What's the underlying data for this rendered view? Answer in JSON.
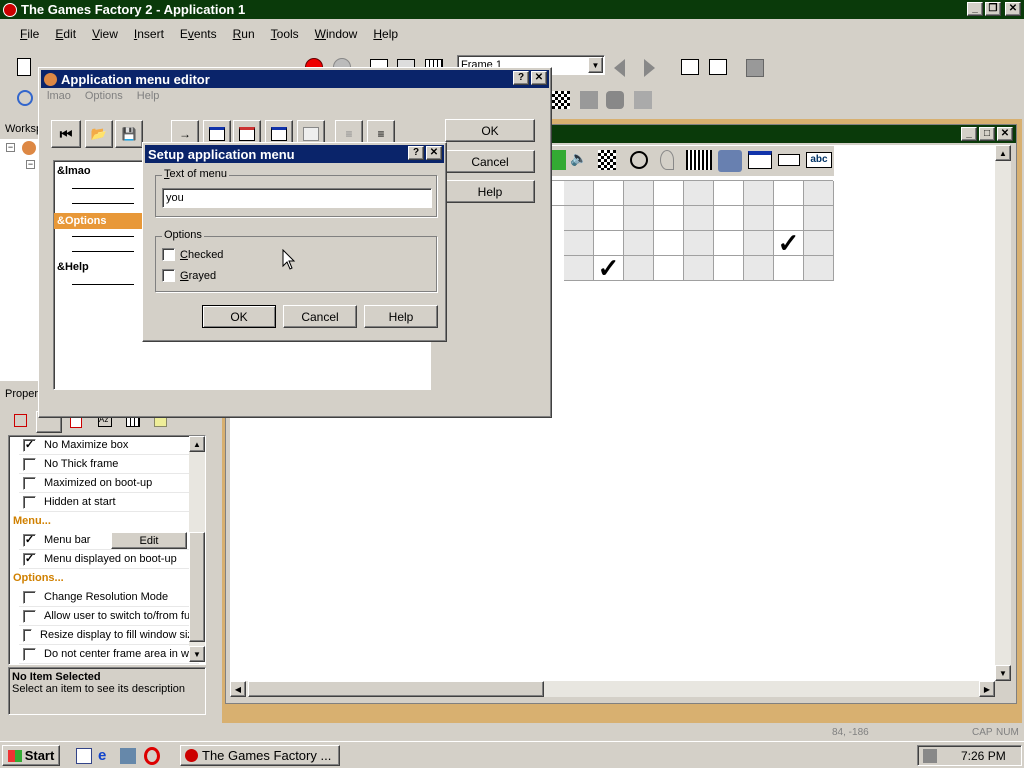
{
  "app": {
    "title": "The Games Factory 2 - Application 1",
    "menu": [
      "File",
      "Edit",
      "View",
      "Insert",
      "Events",
      "Run",
      "Tools",
      "Window",
      "Help"
    ],
    "frame_select": "Frame 1"
  },
  "workspace": {
    "label": "Worksp"
  },
  "properties": {
    "label": "Proper",
    "rows": [
      {
        "label": "No Maximize box",
        "checked": true
      },
      {
        "label": "No Thick frame",
        "checked": false
      },
      {
        "label": "Maximized on boot-up",
        "checked": false
      },
      {
        "label": "Hidden at start",
        "checked": false
      }
    ],
    "menu_header": "Menu...",
    "menu_rows": [
      {
        "label": "Menu bar",
        "checked": true,
        "edit": "Edit"
      },
      {
        "label": "Menu displayed on boot-up",
        "checked": true
      }
    ],
    "options_header": "Options...",
    "options_rows": [
      {
        "label": "Change Resolution Mode",
        "checked": false
      },
      {
        "label": "Allow user to switch to/from full",
        "checked": false
      },
      {
        "label": "Resize display to fill window size",
        "checked": false
      },
      {
        "label": "Do not center frame area in win",
        "checked": false
      }
    ],
    "desc_title": "No Item Selected",
    "desc_text": "Select an item to see its description"
  },
  "menu_editor": {
    "title": "Application menu editor",
    "menu": [
      "lmao",
      "Options",
      "Help"
    ],
    "items": [
      "&lmao",
      "&Options",
      "&Help"
    ],
    "buttons": {
      "ok": "OK",
      "cancel": "Cancel",
      "help": "Help"
    }
  },
  "setup_dialog": {
    "title": "Setup application menu",
    "text_group": "Text of menu",
    "text_value": "you",
    "options_group": "Options",
    "checked_label": "Checked",
    "grayed_label": "Grayed",
    "ok": "OK",
    "cancel": "Cancel",
    "help": "Help"
  },
  "status": {
    "coords": "84, -186",
    "caps": "CAP",
    "num": "NUM"
  },
  "taskbar": {
    "start": "Start",
    "task": "The Games Factory ...",
    "time": "7:26 PM"
  }
}
